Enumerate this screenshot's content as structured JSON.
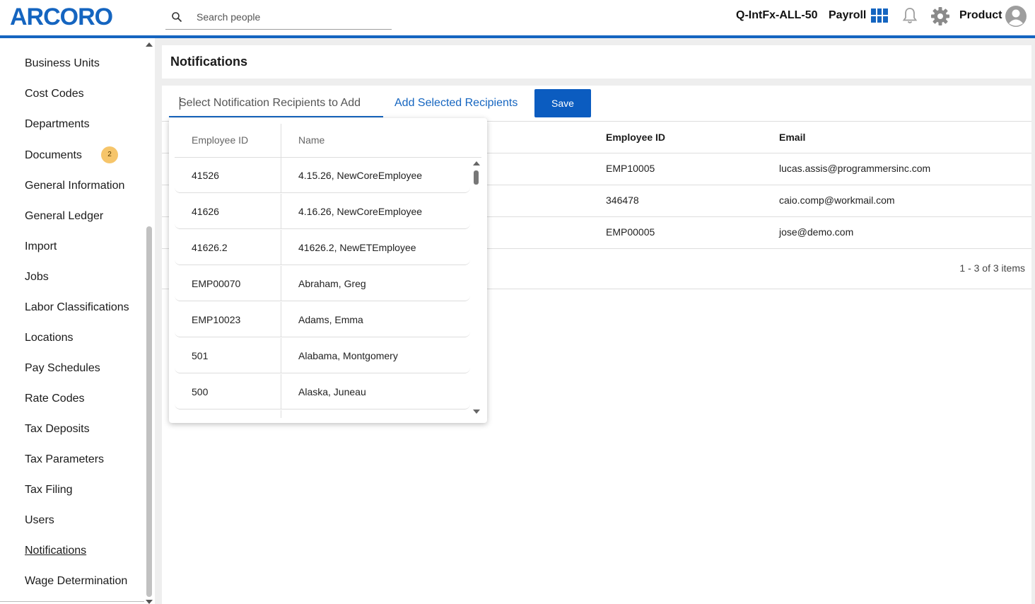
{
  "header": {
    "logo": "ARCORO",
    "search_placeholder": "Search people",
    "company": "Q-IntFx-ALL-50",
    "module": "Payroll",
    "user": "Product"
  },
  "colors": {
    "brand": "#1565c0",
    "badge": "#f6c56a",
    "save_button": "#0b5cc0"
  },
  "sidebar": {
    "items": [
      {
        "label": "Business Units"
      },
      {
        "label": "Cost Codes"
      },
      {
        "label": "Departments"
      },
      {
        "label": "Documents",
        "badge": "2"
      },
      {
        "label": "General Information"
      },
      {
        "label": "General Ledger"
      },
      {
        "label": "Import"
      },
      {
        "label": "Jobs"
      },
      {
        "label": "Labor Classifications"
      },
      {
        "label": "Locations"
      },
      {
        "label": "Pay Schedules"
      },
      {
        "label": "Rate Codes"
      },
      {
        "label": "Tax Deposits"
      },
      {
        "label": "Tax Parameters"
      },
      {
        "label": "Tax Filing"
      },
      {
        "label": "Users"
      },
      {
        "label": "Notifications",
        "active": true
      },
      {
        "label": "Wage Determination"
      }
    ]
  },
  "page": {
    "title": "Notifications",
    "recipient_placeholder": "Select Notification Recipients to Add",
    "add_recipients_label": "Add Selected Recipients",
    "save_label": "Save"
  },
  "grid": {
    "columns": [
      "Employee ID",
      "Email"
    ],
    "rows": [
      {
        "employee_id": "EMP10005",
        "email": "lucas.assis@programmersinc.com"
      },
      {
        "employee_id": "346478",
        "email": "caio.comp@workmail.com"
      },
      {
        "employee_id": "EMP00005",
        "email": "jose@demo.com"
      }
    ],
    "pager": "1 - 3 of 3 items"
  },
  "dropdown": {
    "columns": [
      "Employee ID",
      "Name"
    ],
    "rows": [
      {
        "id": "41526",
        "name": "4.15.26, NewCoreEmployee"
      },
      {
        "id": "41626",
        "name": "4.16.26, NewCoreEmployee"
      },
      {
        "id": "41626.2",
        "name": "41626.2, NewETEmployee"
      },
      {
        "id": "EMP00070",
        "name": "Abraham, Greg"
      },
      {
        "id": "EMP10023",
        "name": "Adams, Emma"
      },
      {
        "id": "501",
        "name": "Alabama, Montgomery"
      },
      {
        "id": "500",
        "name": "Alaska, Juneau"
      }
    ]
  }
}
